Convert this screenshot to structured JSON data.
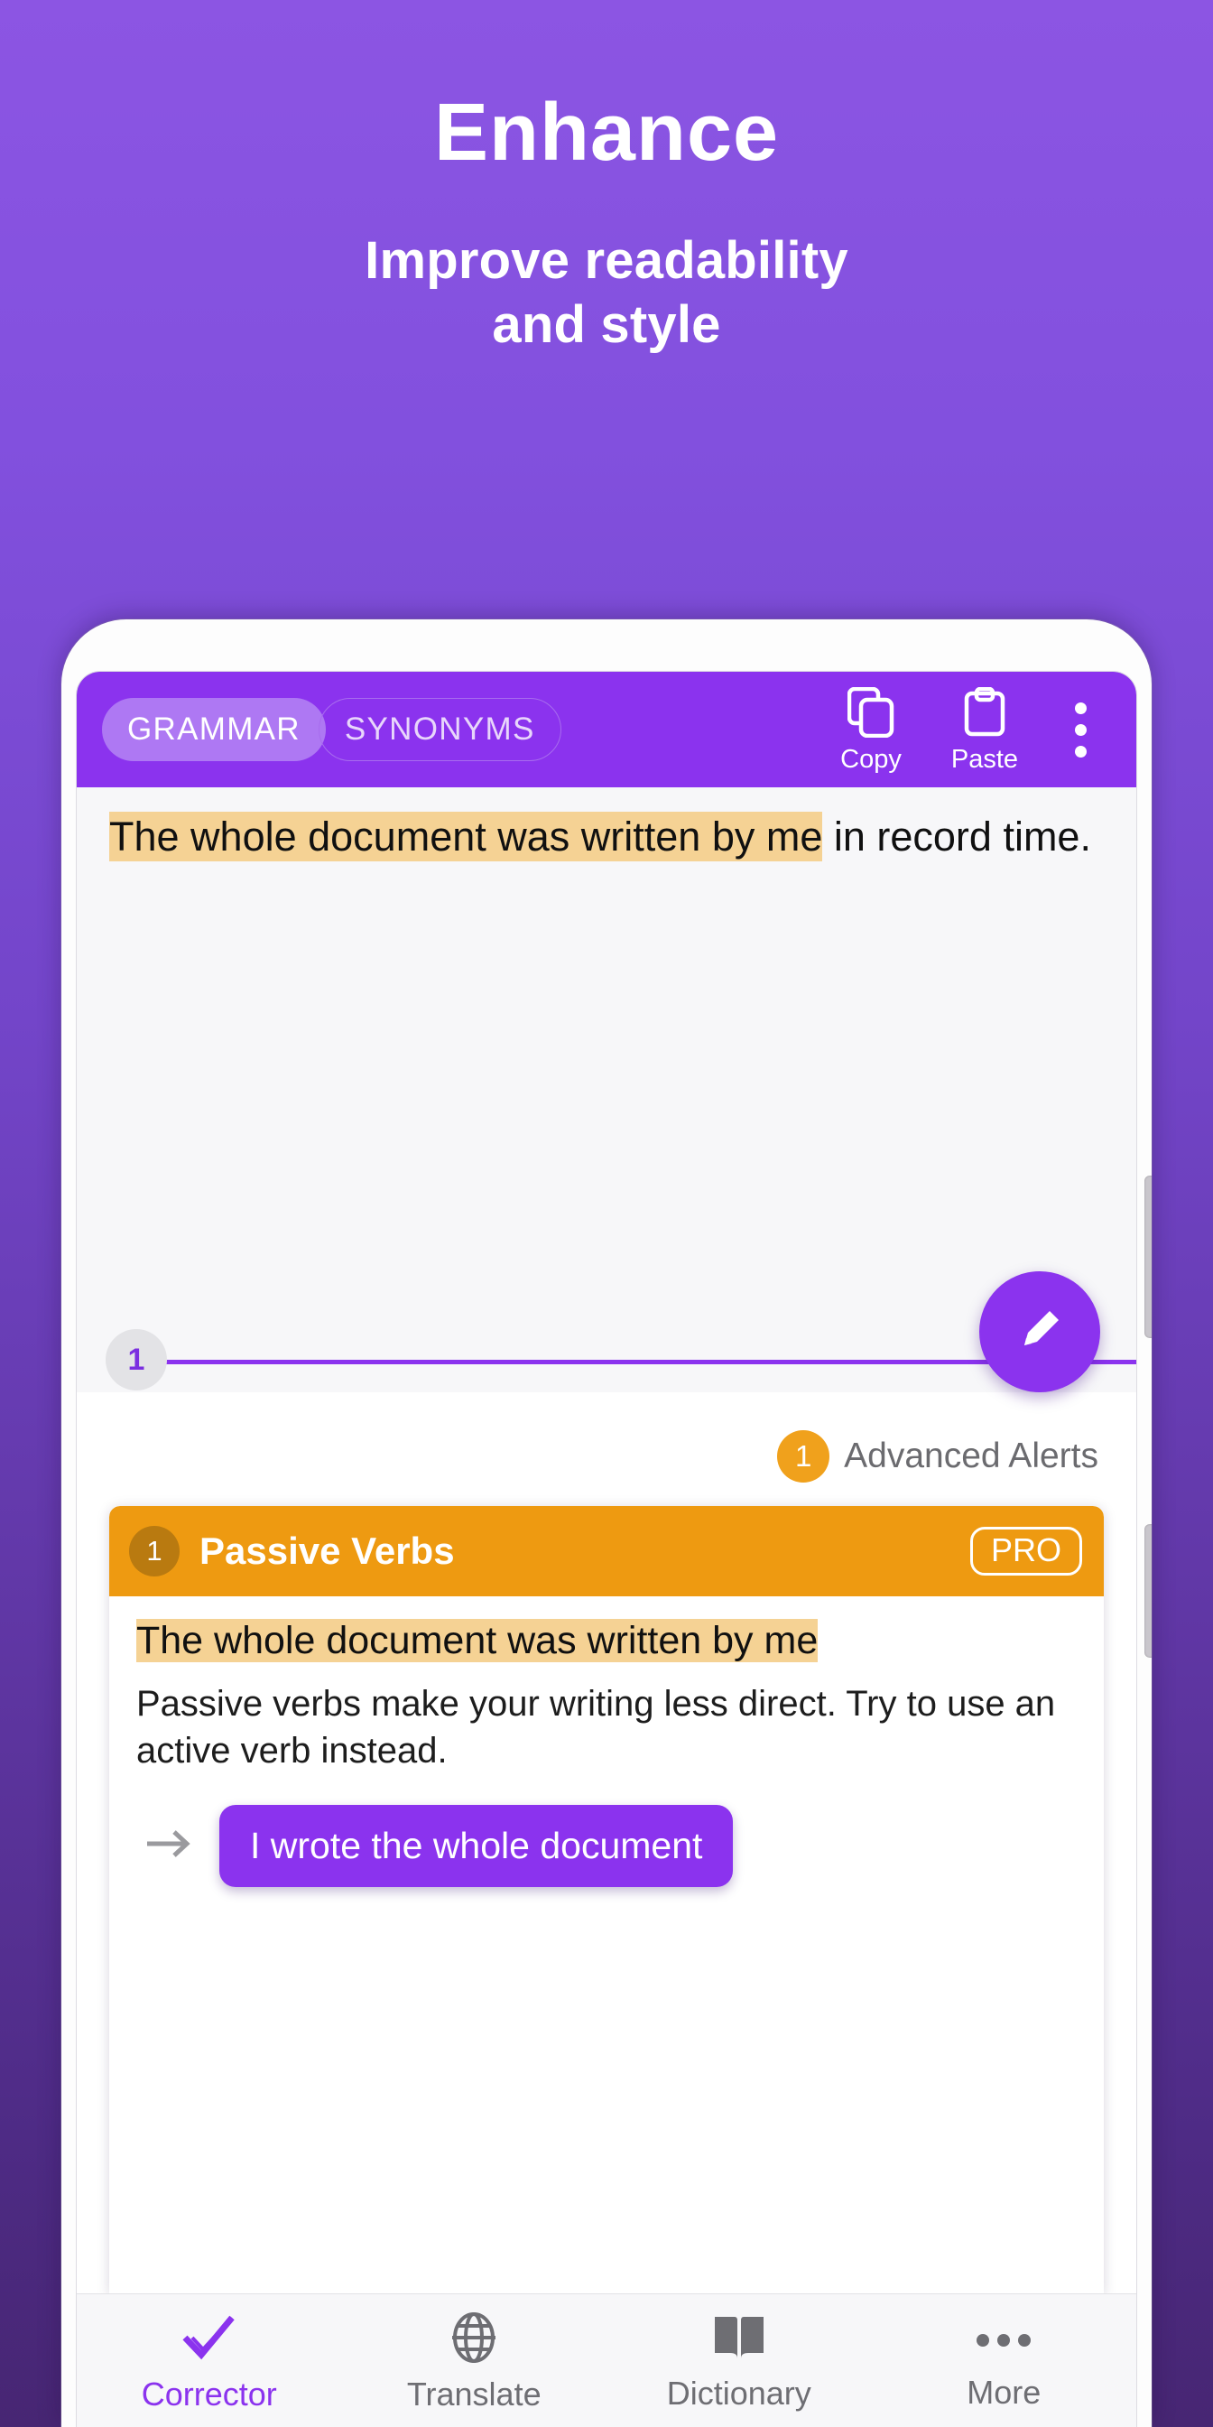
{
  "promo": {
    "title": "Enhance",
    "subtitle_line1": "Improve readability",
    "subtitle_line2": "and style"
  },
  "colors": {
    "brand_purple": "#8B33EE",
    "toolbar_pill_active": "#AE78F3",
    "alert_orange": "#EE9A11",
    "badge_orange": "#F0A11C",
    "highlight": "#F5D294",
    "bg_gradient_top": "#8C55E3",
    "bg_gradient_bottom": "#472673"
  },
  "toolbar": {
    "tab_grammar": "GRAMMAR",
    "tab_synonyms": "SYNONYMS",
    "copy_label": "Copy",
    "paste_label": "Paste",
    "overflow_icon": "kebab-menu-icon"
  },
  "editor": {
    "highlighted_text": "The whole document was written by me",
    "rest_text": " in record time.",
    "divider_badge": "1",
    "fab_icon": "pencil-icon"
  },
  "alerts": {
    "count_badge": "1",
    "label": "Advanced Alerts",
    "card": {
      "badge": "1",
      "title": "Passive Verbs",
      "pro_label": "PRO",
      "quote": "The whole document was written by me",
      "explanation": "Passive verbs make your writing less direct. Try to use an active verb instead.",
      "suggestion": "I wrote the whole document",
      "arrow_icon": "arrow-right-icon"
    }
  },
  "nav": {
    "items": [
      {
        "label": "Corrector",
        "icon": "double-check-icon",
        "active": true
      },
      {
        "label": "Translate",
        "icon": "globe-icon",
        "active": false
      },
      {
        "label": "Dictionary",
        "icon": "open-book-icon",
        "active": false
      },
      {
        "label": "More",
        "icon": "ellipsis-icon",
        "active": false
      }
    ]
  }
}
